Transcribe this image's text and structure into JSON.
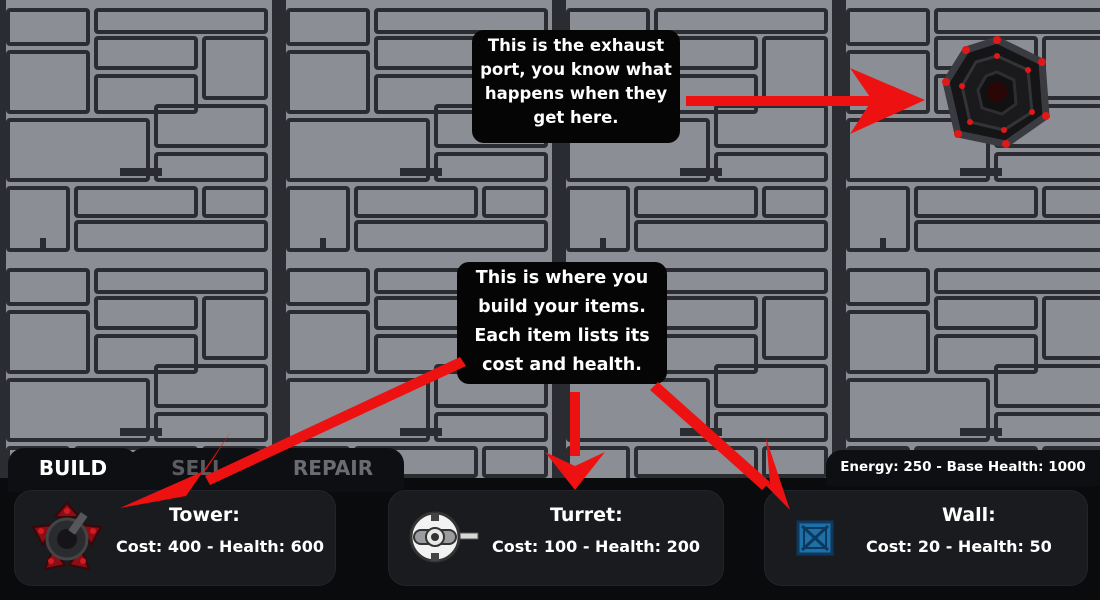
{
  "callouts": {
    "exhaust_lines": [
      "This is the exhaust",
      "port, you know what",
      "happens when they",
      "get here."
    ],
    "build_lines": [
      "This is where you",
      "build your items.",
      "Each item lists its",
      "cost and health."
    ]
  },
  "tabs": [
    {
      "label": "BUILD",
      "active": true
    },
    {
      "label": "SELL",
      "active": false
    },
    {
      "label": "REPAIR",
      "active": false
    }
  ],
  "stats": {
    "text": "Energy: 250 - Base Health: 1000"
  },
  "items": [
    {
      "name": "Tower:",
      "details": "Cost: 400 - Health: 600",
      "icon": "tower-icon"
    },
    {
      "name": "Turret:",
      "details": "Cost: 100 - Health: 200",
      "icon": "turret-icon"
    },
    {
      "name": "Wall:",
      "details": "Cost: 20 - Health: 50",
      "icon": "wall-icon"
    }
  ],
  "colors": {
    "arrow": "#ee1111",
    "panel": "#0e0f12",
    "wall_icon": "#1f6fa8"
  }
}
